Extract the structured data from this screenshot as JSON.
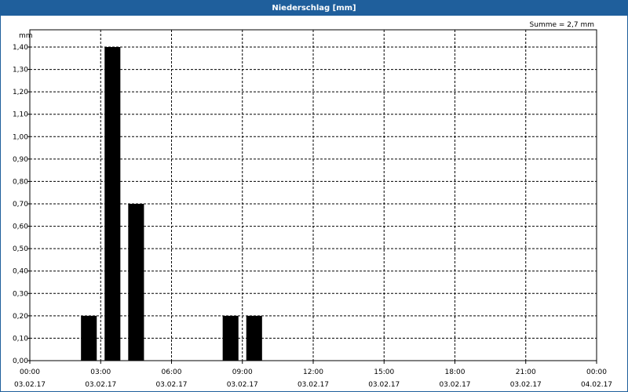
{
  "window": {
    "title": "Niederschlag [mm]"
  },
  "annotation": "Summe = 2,7 mm",
  "colors": {
    "titlebar": "#1f5f9c",
    "bars": "#000000",
    "grid": "#000000"
  },
  "chart_data": {
    "type": "bar",
    "title": "Niederschlag [mm]",
    "ylabel": "mm",
    "xlabel": "",
    "ylim": [
      0,
      1.4
    ],
    "xlim": [
      "2017-02-03 00:00",
      "2017-02-04 00:00"
    ],
    "grid": true,
    "y_ticks": [
      "0,00",
      "0,10",
      "0,20",
      "0,30",
      "0,40",
      "0,50",
      "0,60",
      "0,70",
      "0,80",
      "0,90",
      "1,00",
      "1,10",
      "1,20",
      "1,30",
      "1,40"
    ],
    "x_ticks": [
      {
        "time": "00:00",
        "date": "03.02.17"
      },
      {
        "time": "03:00",
        "date": "03.02.17"
      },
      {
        "time": "06:00",
        "date": "03.02.17"
      },
      {
        "time": "09:00",
        "date": "03.02.17"
      },
      {
        "time": "12:00",
        "date": "03.02.17"
      },
      {
        "time": "15:00",
        "date": "03.02.17"
      },
      {
        "time": "18:00",
        "date": "03.02.17"
      },
      {
        "time": "21:00",
        "date": "03.02.17"
      },
      {
        "time": "00:00",
        "date": "04.02.17"
      }
    ],
    "series": [
      {
        "values": [
          {
            "start": "02:00",
            "end": "03:00",
            "value": 0.2
          },
          {
            "start": "03:00",
            "end": "04:00",
            "value": 1.4
          },
          {
            "start": "04:00",
            "end": "05:00",
            "value": 0.7
          },
          {
            "start": "08:00",
            "end": "09:00",
            "value": 0.2
          },
          {
            "start": "09:00",
            "end": "10:00",
            "value": 0.2
          }
        ]
      }
    ]
  }
}
